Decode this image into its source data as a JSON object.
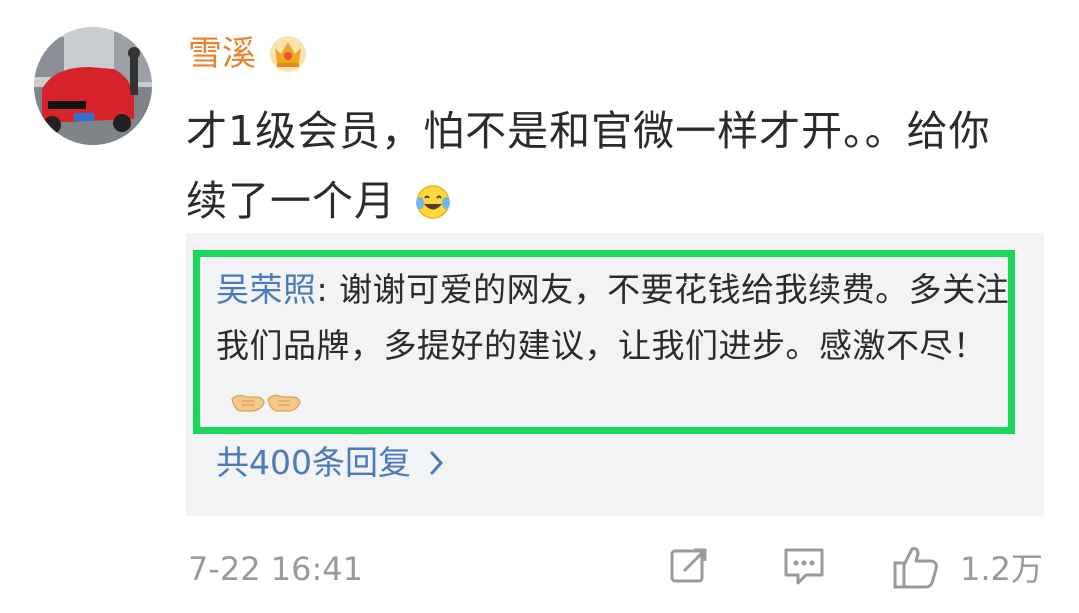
{
  "user": {
    "name": "雪溪",
    "badge_icon": "crown-vip-icon"
  },
  "comment": {
    "text": "才1级会员，怕不是和官微一样才开。。给你续了一个月",
    "emoji_icon": "laugh-cry-icon"
  },
  "reply": {
    "author": "吴荣照",
    "separator": ": ",
    "text": "谢谢可爱的网友，不要花钱给我续费。多关注我们品牌，多提好的建议，让我们进步。感激不尽！",
    "emoji_icon": "handshake-icon"
  },
  "more_replies": {
    "label": "共400条回复"
  },
  "footer": {
    "timestamp": "7-22 16:41",
    "like_count": "1.2万"
  },
  "colors": {
    "username": "#e8842c",
    "link_blue": "#4b7ab8",
    "highlight_border": "#1ed65a",
    "reply_bg": "#f2f3f5",
    "meta_gray": "#9a9a9a"
  }
}
